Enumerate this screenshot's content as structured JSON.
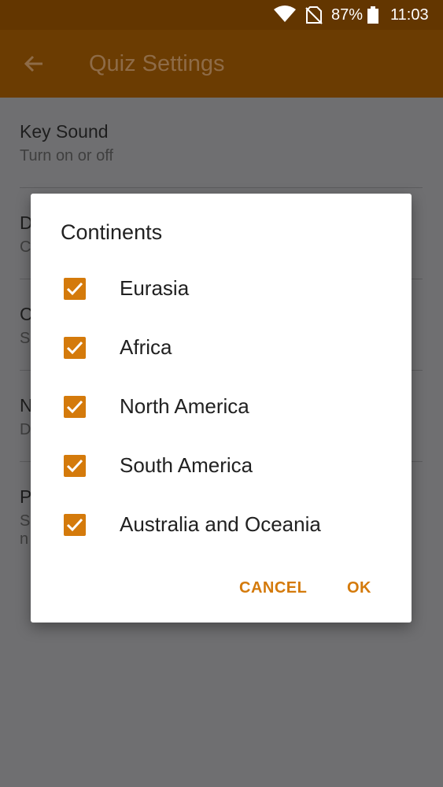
{
  "status_bar": {
    "battery_percent": "87%",
    "time": "11:03"
  },
  "app_bar": {
    "title": "Quiz Settings"
  },
  "settings": {
    "items": [
      {
        "title": "Key Sound",
        "summary": "Turn on or off"
      },
      {
        "title": "D",
        "summary": "C"
      },
      {
        "title": "C",
        "summary": "S"
      },
      {
        "title": "N",
        "summary": "D"
      },
      {
        "title": "P",
        "summary": "S",
        "summary2": "n"
      }
    ]
  },
  "dialog": {
    "title": "Continents",
    "options": [
      {
        "label": "Eurasia",
        "checked": true
      },
      {
        "label": "Africa",
        "checked": true
      },
      {
        "label": "North America",
        "checked": true
      },
      {
        "label": "South America",
        "checked": true
      },
      {
        "label": "Australia and Oceania",
        "checked": true
      }
    ],
    "cancel_label": "CANCEL",
    "ok_label": "OK"
  },
  "colors": {
    "accent": "#d47a0b",
    "status_bar": "#633600",
    "app_bar": "#6b3c02"
  }
}
